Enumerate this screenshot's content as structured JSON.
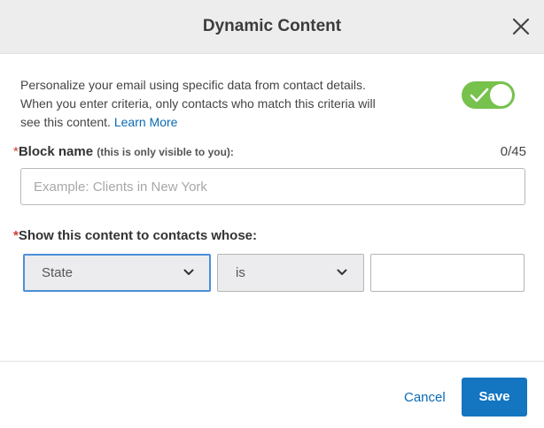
{
  "dialog": {
    "title": "Dynamic Content",
    "close_icon": "close-icon"
  },
  "intro": {
    "description": "Personalize your email using specific data from contact details. When you enter criteria, only contacts who match this criteria will see this content. ",
    "learn_more": "Learn More"
  },
  "toggle": {
    "state": "on",
    "color": "#77c14d"
  },
  "block_name": {
    "required_mark": "*",
    "label": "Block name",
    "sublabel": "(this is only visible to you):",
    "counter": "0/45",
    "value": "",
    "placeholder": "Example: Clients in New York"
  },
  "criteria": {
    "required_mark": "*",
    "label": "Show this content to contacts whose:",
    "field_select": "State",
    "operator_select": "is",
    "value": ""
  },
  "footer": {
    "cancel_label": "Cancel",
    "save_label": "Save",
    "save_color": "#1475c1"
  }
}
